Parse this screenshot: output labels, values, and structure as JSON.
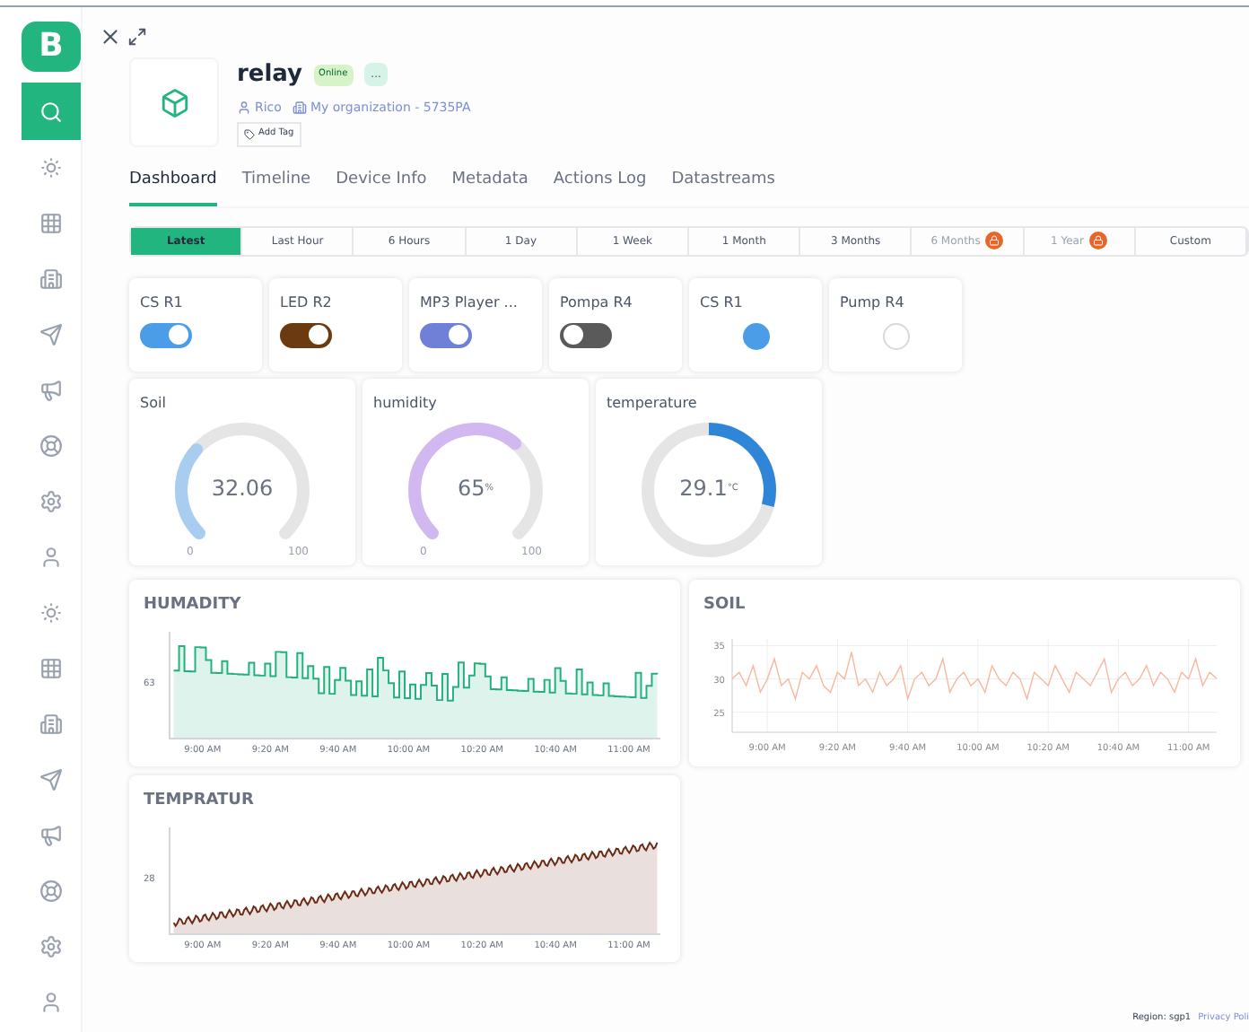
{
  "sidebar": {
    "logo": "B",
    "items": [
      {
        "kind": "search",
        "selected": true
      },
      {
        "kind": "sun",
        "selected": false
      },
      {
        "kind": "grid",
        "selected": false
      },
      {
        "kind": "building",
        "selected": false
      },
      {
        "kind": "send",
        "selected": false
      },
      {
        "kind": "megaphone",
        "selected": false
      },
      {
        "kind": "lifebuoy",
        "selected": false
      },
      {
        "kind": "settings",
        "selected": false
      },
      {
        "kind": "user",
        "selected": false
      },
      {
        "kind": "sun",
        "selected": false
      },
      {
        "kind": "grid",
        "selected": false
      },
      {
        "kind": "building",
        "selected": false
      },
      {
        "kind": "send",
        "selected": false
      },
      {
        "kind": "megaphone",
        "selected": false
      },
      {
        "kind": "lifebuoy",
        "selected": false
      },
      {
        "kind": "settings",
        "selected": false
      },
      {
        "kind": "user",
        "selected": false
      }
    ]
  },
  "device": {
    "name": "relay",
    "status": "Online",
    "more": "...",
    "owner": "Rico",
    "organization": "My organization - 5735PA",
    "add_tag": "Add Tag"
  },
  "tabs": [
    {
      "label": "Dashboard",
      "selected": true
    },
    {
      "label": "Timeline",
      "selected": false
    },
    {
      "label": "Device Info",
      "selected": false
    },
    {
      "label": "Metadata",
      "selected": false
    },
    {
      "label": "Actions Log",
      "selected": false
    },
    {
      "label": "Datastreams",
      "selected": false
    }
  ],
  "time_ranges": [
    {
      "label": "Latest",
      "selected": true,
      "locked": false
    },
    {
      "label": "Last Hour",
      "selected": false,
      "locked": false
    },
    {
      "label": "6 Hours",
      "selected": false,
      "locked": false
    },
    {
      "label": "1 Day",
      "selected": false,
      "locked": false
    },
    {
      "label": "1 Week",
      "selected": false,
      "locked": false
    },
    {
      "label": "1 Month",
      "selected": false,
      "locked": false
    },
    {
      "label": "3 Months",
      "selected": false,
      "locked": false
    },
    {
      "label": "6 Months",
      "selected": false,
      "locked": true
    },
    {
      "label": "1 Year",
      "selected": false,
      "locked": true
    },
    {
      "label": "Custom",
      "selected": false,
      "locked": false
    }
  ],
  "controls": [
    {
      "kind": "switch",
      "label": "CS R1",
      "on": true,
      "color": "#4a9de6"
    },
    {
      "kind": "switch",
      "label": "LED R2",
      "on": true,
      "color": "#6b3a10"
    },
    {
      "kind": "switch",
      "label": "MP3 Player ...",
      "on": true,
      "color": "#6f80d6"
    },
    {
      "kind": "switch",
      "label": "Pompa R4",
      "on": false,
      "color": "#5a5a5a"
    },
    {
      "kind": "led",
      "label": "CS R1",
      "on": true,
      "color": "#4a9de6"
    },
    {
      "kind": "led",
      "label": "Pump R4",
      "on": false
    }
  ],
  "gauges": [
    {
      "kind": "arc",
      "label": "Soil",
      "value": "32.06",
      "min": "0",
      "max": "100",
      "color": "#a9cdf0"
    },
    {
      "kind": "arc",
      "label": "humidity",
      "value": "65",
      "unit": "%",
      "min": "0",
      "max": "100",
      "color": "#d2b8f0"
    },
    {
      "kind": "ring",
      "label": "temperature",
      "value": "29.1",
      "unit": "°C",
      "color": "#2f86d8"
    }
  ],
  "charts": [
    {
      "kind": "steps",
      "title": "HUMADITY",
      "y_labels": [
        "63"
      ],
      "x_labels": [
        "9:00 AM",
        "9:20 AM",
        "9:40 AM",
        "10:00 AM",
        "10:20 AM",
        "10:40 AM",
        "11:00 AM"
      ],
      "color": "#22b07d"
    },
    {
      "kind": "noise",
      "title": "SOIL",
      "chart_data": {
        "type": "line",
        "grid": true,
        "ylim": [
          22,
          36
        ],
        "yticks": [
          25,
          30,
          35
        ],
        "categories": [
          null,
          null,
          null,
          null,
          null,
          "9:00 AM",
          null,
          null,
          null,
          null,
          null,
          null,
          null,
          null,
          null,
          "9:20 AM",
          null,
          null,
          null,
          null,
          null,
          null,
          null,
          null,
          null,
          "9:40 AM",
          null,
          null,
          null,
          null,
          null,
          null,
          null,
          null,
          null,
          "10:00 AM",
          null,
          null,
          null,
          null,
          null,
          null,
          null,
          null,
          null,
          "10:20 AM",
          null,
          null,
          null,
          null,
          null,
          null,
          null,
          null,
          null,
          "10:40 AM",
          null,
          null,
          null,
          null,
          null,
          null,
          null,
          null,
          null,
          "11:00 AM",
          null,
          null,
          null,
          null
        ],
        "series": [
          {
            "color": "#f6b8a0",
            "values": [
              30,
              31,
              29,
              32,
              28,
              30,
              33,
              29,
              30,
              27,
              31,
              30,
              32,
              29,
              28,
              31,
              30,
              34,
              29,
              30,
              28,
              31,
              29,
              30,
              32,
              27,
              30,
              31,
              29,
              30,
              33,
              28,
              30,
              31,
              29,
              30,
              28,
              32,
              30,
              29,
              31,
              30,
              27,
              31,
              30,
              29,
              32,
              30,
              28,
              31,
              30,
              29,
              31,
              33,
              28,
              30,
              31,
              29,
              30,
              32,
              29,
              31,
              30,
              28,
              31,
              30,
              33,
              29,
              31,
              30
            ]
          }
        ]
      }
    },
    {
      "kind": "rising",
      "title": "TEMPRATUR",
      "y_labels": [
        "28"
      ],
      "x_labels": [
        "9:00 AM",
        "9:20 AM",
        "9:40 AM",
        "10:00 AM",
        "10:20 AM",
        "10:40 AM",
        "11:00 AM"
      ],
      "color": "#6b2a14"
    }
  ],
  "footer": {
    "region": "Region: sgp1",
    "privacy": "Privacy Poli"
  }
}
